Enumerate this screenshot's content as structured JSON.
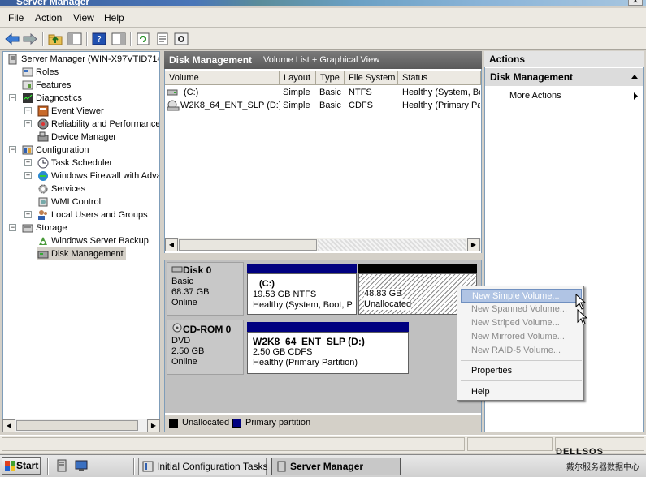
{
  "window": {
    "title": "Server Manager",
    "close_glyph": "✕"
  },
  "menu": [
    "File",
    "Action",
    "View",
    "Help"
  ],
  "tree": {
    "root": "Server Manager (WIN-X97VTID714",
    "roles": "Roles",
    "features": "Features",
    "diagnostics": "Diagnostics",
    "event_viewer": "Event Viewer",
    "reliability": "Reliability and Performance",
    "device_manager": "Device Manager",
    "configuration": "Configuration",
    "task_scheduler": "Task Scheduler",
    "firewall": "Windows Firewall with Adva",
    "services": "Services",
    "wmi": "WMI Control",
    "users_groups": "Local Users and Groups",
    "storage": "Storage",
    "backup": "Windows Server Backup",
    "disk_management": "Disk Management"
  },
  "center": {
    "title": "Disk Management",
    "view": "Volume List + Graphical View",
    "columns": [
      "Volume",
      "Layout",
      "Type",
      "File System",
      "Status"
    ],
    "rows": [
      {
        "volume": "(C:)",
        "layout": "Simple",
        "type": "Basic",
        "fs": "NTFS",
        "status": "Healthy (System, Bo"
      },
      {
        "volume": "W2K8_64_ENT_SLP (D:)",
        "layout": "Simple",
        "type": "Basic",
        "fs": "CDFS",
        "status": "Healthy (Primary Pa"
      }
    ]
  },
  "disks": {
    "disk0": {
      "name": "Disk 0",
      "type": "Basic",
      "size": "68.37 GB",
      "state": "Online"
    },
    "c_part": {
      "name": "(C:)",
      "size": "19.53 GB NTFS",
      "status": "Healthy (System, Boot, P"
    },
    "unalloc": {
      "size": "48.83 GB",
      "label": "Unallocated"
    },
    "cdrom": {
      "name": "CD-ROM 0",
      "type": "DVD",
      "size": "2.50 GB",
      "state": "Online"
    },
    "d_part": {
      "name": "W2K8_64_ENT_SLP  (D:)",
      "size": "2.50 GB CDFS",
      "status": "Healthy (Primary Partition)"
    }
  },
  "legend": {
    "unallocated": "Unallocated",
    "primary": "Primary partition",
    "unalloc_color": "#000000",
    "primary_color": "#000080"
  },
  "actions": {
    "header": "Actions",
    "section": "Disk Management",
    "more": "More Actions"
  },
  "context_menu": {
    "new_simple": "New Simple Volume...",
    "new_spanned": "New Spanned Volume...",
    "new_striped": "New Striped Volume...",
    "new_mirrored": "New Mirrored Volume...",
    "new_raid5": "New RAID-5 Volume...",
    "properties": "Properties",
    "help": "Help"
  },
  "taskbar": {
    "start": "Start",
    "task1": "Initial Configuration Tasks",
    "task2": "Server Manager"
  },
  "watermark": {
    "line1": "DELLSOS",
    "line2": "戴尔服务器数据中心"
  }
}
